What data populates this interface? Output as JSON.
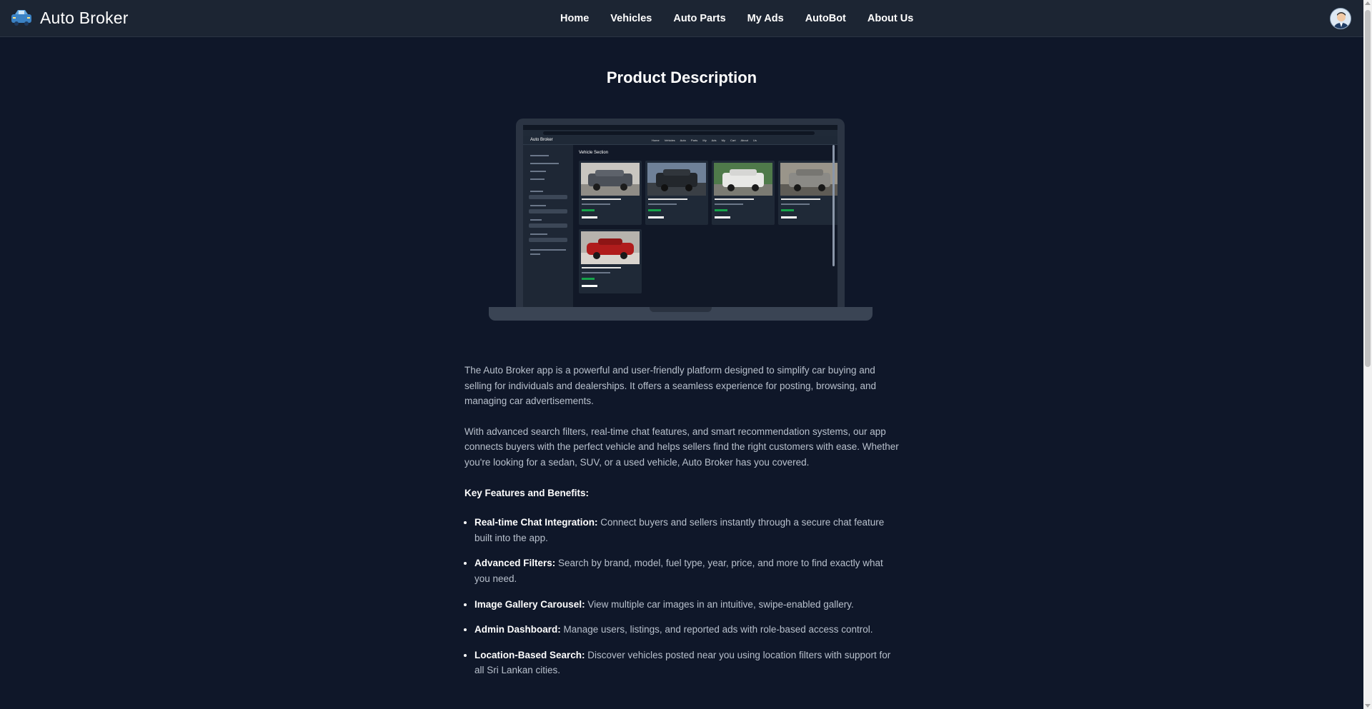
{
  "app": {
    "name": "Auto Broker"
  },
  "nav": {
    "links": [
      "Home",
      "Vehicles",
      "Auto Parts",
      "My Ads",
      "AutoBot",
      "About Us"
    ]
  },
  "page": {
    "title": "Product Description"
  },
  "mockup": {
    "brand": "Auto Broker",
    "nav_links": "Home Vehicles Auto Parts My Ads My Cart About Us",
    "section_heading": "Vehicle Section"
  },
  "description": {
    "para1": "The Auto Broker app is a powerful and user-friendly platform designed to simplify car buying and selling for individuals and dealerships. It offers a seamless experience for posting, browsing, and managing car advertisements.",
    "para2": "With advanced search filters, real-time chat features, and smart recommendation systems, our app connects buyers with the perfect vehicle and helps sellers find the right customers with ease. Whether you're looking for a sedan, SUV, or a used vehicle, Auto Broker has you covered.",
    "key_features_title": "Key Features and Benefits:",
    "features": [
      {
        "title": "Real-time Chat Integration:",
        "text": " Connect buyers and sellers instantly through a secure chat feature built into the app."
      },
      {
        "title": "Advanced Filters:",
        "text": " Search by brand, model, fuel type, year, price, and more to find exactly what you need."
      },
      {
        "title": "Image Gallery Carousel:",
        "text": " View multiple car images in an intuitive, swipe-enabled gallery."
      },
      {
        "title": "Admin Dashboard:",
        "text": " Manage users, listings, and reported ads with role-based access control."
      },
      {
        "title": "Location-Based Search:",
        "text": " Discover vehicles posted near you using location filters with support for all Sri Lankan cities."
      }
    ]
  },
  "colors": {
    "background": "#0f1729",
    "navbar": "#1c2533",
    "accent_green": "#16a34a"
  }
}
